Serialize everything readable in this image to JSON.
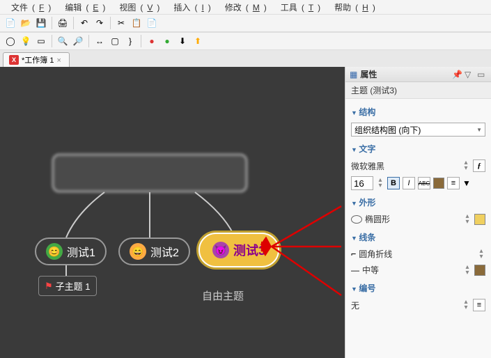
{
  "menu": {
    "file": "文件",
    "file_key": "F",
    "edit": "编辑",
    "edit_key": "E",
    "view": "视图",
    "view_key": "V",
    "insert": "插入",
    "insert_key": "I",
    "modify": "修改",
    "modify_key": "M",
    "tools": "工具",
    "tools_key": "T",
    "help": "帮助",
    "help_key": "H"
  },
  "tab": {
    "title": "*工作簿 1",
    "close_hint": "×"
  },
  "canvas": {
    "node1": "测试1",
    "node2": "测试2",
    "node3": "测试3",
    "sub1": "子主题 1",
    "free": "自由主题"
  },
  "panel": {
    "title": "属性",
    "subtitle": "主题 (测试3)",
    "sections": {
      "structure": "结构",
      "structure_value": "组织结构图 (向下)",
      "text": "文字",
      "font_name": "微软雅黑",
      "font_size": "16",
      "bold": "B",
      "italic": "I",
      "strike": "ABC",
      "shape": "外形",
      "shape_value": "椭圆形",
      "line": "线条",
      "line_style": "圆角折线",
      "line_weight": "中等",
      "number": "编号",
      "number_value": "无"
    }
  }
}
